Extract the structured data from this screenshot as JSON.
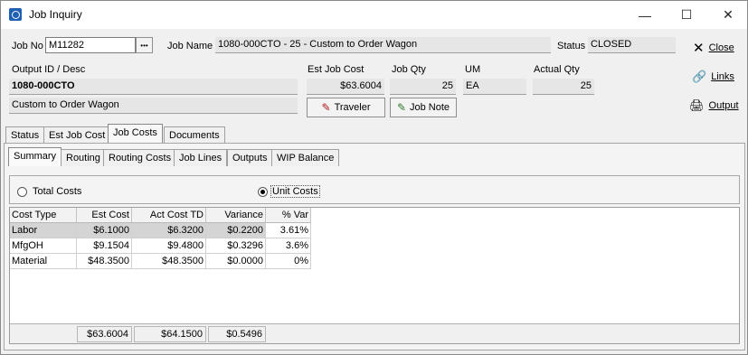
{
  "window": {
    "title": "Job Inquiry",
    "minimize": "—",
    "maximize": "☐",
    "close": "✕"
  },
  "header": {
    "job_no_label": "Job No",
    "job_no_value": "M11282",
    "lookup_label": "•••",
    "job_name_label": "Job Name",
    "job_name_value": "1080-000CTO - 25 - Custom to Order Wagon",
    "status_label": "Status",
    "status_value": "CLOSED",
    "output_label": "Output ID / Desc",
    "output_id": "1080-000CTO",
    "output_desc": "Custom to Order Wagon",
    "est_job_cost_label": "Est Job Cost",
    "est_job_cost_value": "$63.6004",
    "job_qty_label": "Job Qty",
    "job_qty_value": "25",
    "um_label": "UM",
    "um_value": "EA",
    "actual_qty_label": "Actual Qty",
    "actual_qty_value": "25"
  },
  "buttons": {
    "traveler": "Traveler",
    "job_note": "Job Note",
    "close": "Close",
    "links": "Links",
    "output": "Output"
  },
  "tabs": [
    "Status",
    "Est Job Cost",
    "Job Costs",
    "Documents"
  ],
  "subtabs": [
    "Summary",
    "Routing",
    "Routing Costs",
    "Job Lines",
    "Outputs",
    "WIP Balance"
  ],
  "options": {
    "total_costs": "Total Costs",
    "unit_costs": "Unit Costs",
    "selected": "unit_costs"
  },
  "table": {
    "columns": [
      "Cost Type",
      "Est Cost",
      "Act Cost TD",
      "Variance",
      "% Var"
    ],
    "rows": [
      [
        "Labor",
        "$6.1000",
        "$6.3200",
        "$0.2200",
        "3.61%"
      ],
      [
        "MfgOH",
        "$9.1504",
        "$9.4800",
        "$0.3296",
        "3.6%"
      ],
      [
        "Material",
        "$48.3500",
        "$48.3500",
        "$0.0000",
        "0%"
      ]
    ],
    "totals": [
      "",
      "$63.6004",
      "$64.1500",
      "$0.5496"
    ]
  }
}
